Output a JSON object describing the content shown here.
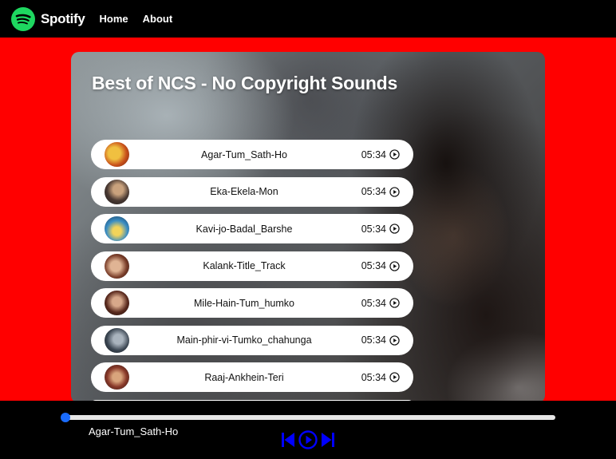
{
  "navbar": {
    "brand": "Spotify",
    "links": [
      "Home",
      "About"
    ],
    "logo_icon": "spotify-logo-icon",
    "logo_color": "#1ed760"
  },
  "playlist": {
    "title": "Best of NCS - No Copyright Sounds",
    "songs": [
      {
        "name": "Agar-Tum_Sath-Ho",
        "duration": "05:34"
      },
      {
        "name": "Eka-Ekela-Mon",
        "duration": "05:34"
      },
      {
        "name": "Kavi-jo-Badal_Barshe",
        "duration": "05:34"
      },
      {
        "name": "Kalank-Title_Track",
        "duration": "05:34"
      },
      {
        "name": "Mile-Hain-Tum_humko",
        "duration": "05:34"
      },
      {
        "name": "Main-phir-vi-Tumko_chahunga",
        "duration": "05:34"
      },
      {
        "name": "Raaj-Ankhein-Teri",
        "duration": "05:34"
      }
    ]
  },
  "player": {
    "now_playing": "Agar-Tum_Sath-Ho",
    "progress": 0,
    "controls": [
      "previous-icon",
      "play-circle-icon",
      "next-icon"
    ],
    "accent_color": "#1a6cff",
    "control_color": "#0000ff"
  },
  "colors": {
    "page_background": "#ff0000",
    "bar_background": "#000000"
  }
}
